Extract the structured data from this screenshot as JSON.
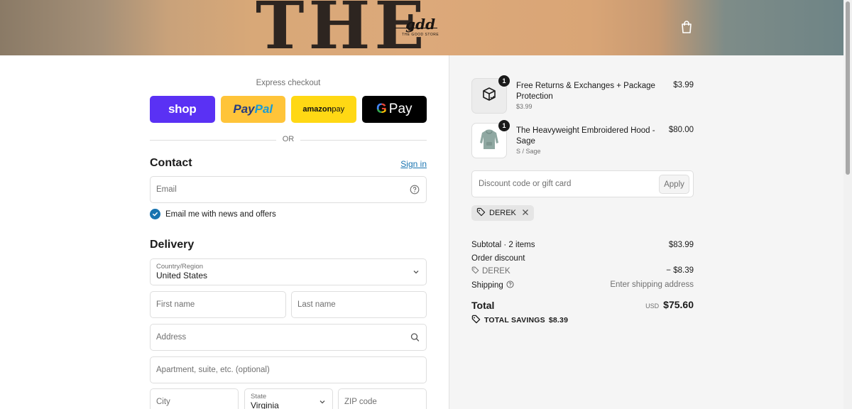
{
  "banner": {
    "shirt_text": "THE",
    "logo_text": "gdd",
    "logo_subtext": "THE GOOD STORE"
  },
  "express": {
    "title": "Express checkout",
    "buttons": [
      {
        "name": "shop",
        "label": "shop"
      },
      {
        "name": "paypal",
        "label_a": "Pay",
        "label_b": "Pal"
      },
      {
        "name": "amazon-pay",
        "label_a": "amazon",
        "label_b": " pay"
      },
      {
        "name": "google-pay",
        "label_a": "G",
        "label_b": "Pay"
      }
    ],
    "or_label": "OR"
  },
  "contact": {
    "title": "Contact",
    "sign_in": "Sign in",
    "email_placeholder": "Email",
    "newsletter_label": "Email me with news and offers",
    "newsletter_checked": true
  },
  "delivery": {
    "title": "Delivery",
    "country_label": "Country/Region",
    "country_value": "United States",
    "first_name_placeholder": "First name",
    "last_name_placeholder": "Last name",
    "address_placeholder": "Address",
    "apartment_placeholder": "Apartment, suite, etc. (optional)",
    "city_placeholder": "City",
    "state_label": "State",
    "state_value": "Virginia",
    "zip_placeholder": "ZIP code"
  },
  "summary": {
    "items": [
      {
        "name": "Free Returns & Exchanges + Package Protection",
        "variant": "$3.99",
        "price": "$3.99",
        "qty": "1",
        "icon": "package-icon"
      },
      {
        "name": "The Heavyweight Embroidered Hood - Sage",
        "variant": "S / Sage",
        "price": "$80.00",
        "qty": "1",
        "icon": "hoodie-icon"
      }
    ],
    "discount_placeholder": "Discount code or gift card",
    "apply_label": "Apply",
    "applied_code": "DEREK",
    "subtotal_label": "Subtotal · 2 items",
    "subtotal_value": "$83.99",
    "order_discount_label": "Order discount",
    "discount_code": "DEREK",
    "discount_value": "− $8.39",
    "shipping_label": "Shipping",
    "shipping_value": "Enter shipping address",
    "total_label": "Total",
    "currency": "USD",
    "total_value": "$75.60",
    "savings_label": "TOTAL SAVINGS",
    "savings_value": "$8.39"
  },
  "colors": {
    "accent": "#1773b0",
    "shop_purple": "#5a31f4",
    "paypal_yellow": "#ffc439",
    "amazon_yellow": "#ffd814",
    "panel_gray": "#f5f5f5"
  }
}
